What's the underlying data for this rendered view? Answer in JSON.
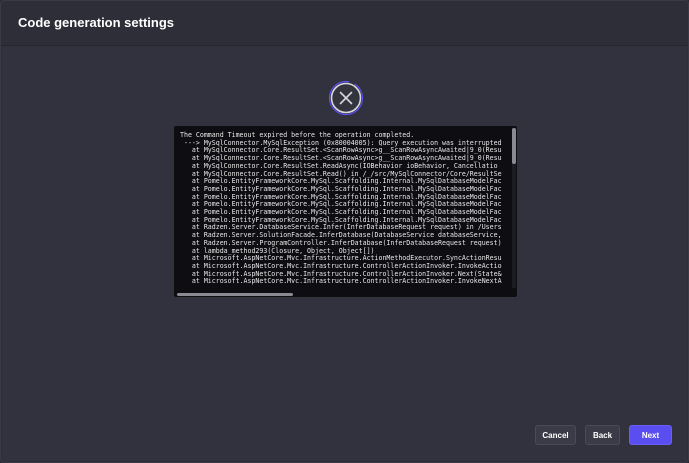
{
  "dialog": {
    "title": "Code generation settings"
  },
  "error": {
    "icon": "close-circle-icon",
    "log_lines": [
      "The Command Timeout expired before the operation completed.",
      " ---> MySqlConnector.MySqlException (0x80004005): Query execution was interrupted",
      "   at MySqlConnector.Core.ResultSet.<ScanRowAsync>g__ScanRowAsyncAwaited|9_0(Resu",
      "   at MySqlConnector.Core.ResultSet.<ScanRowAsync>g__ScanRowAsyncAwaited|9_0(Resu",
      "   at MySqlConnector.Core.ResultSet.ReadAsync(IOBehavior ioBehavior, Cancellatio",
      "   at MySqlConnector.Core.ResultSet.Read() in /_/src/MySqlConnector/Core/ResultSe",
      "   at Pomelo.EntityFrameworkCore.MySql.Scaffolding.Internal.MySqlDatabaseModelFac",
      "   at Pomelo.EntityFrameworkCore.MySql.Scaffolding.Internal.MySqlDatabaseModelFac",
      "   at Pomelo.EntityFrameworkCore.MySql.Scaffolding.Internal.MySqlDatabaseModelFac",
      "   at Pomelo.EntityFrameworkCore.MySql.Scaffolding.Internal.MySqlDatabaseModelFac",
      "   at Pomelo.EntityFrameworkCore.MySql.Scaffolding.Internal.MySqlDatabaseModelFac",
      "   at Pomelo.EntityFrameworkCore.MySql.Scaffolding.Internal.MySqlDatabaseModelFac",
      "   at Radzen.Server.DatabaseService.Infer(InferDatabaseRequest request) in /Users",
      "   at Radzen.Server.SolutionFacade.InferDatabase(DatabaseService databaseService,",
      "   at Radzen.Server.ProgramController.InferDatabase(InferDatabaseRequest request)",
      "   at lambda_method293(Closure, Object, Object[])",
      "   at Microsoft.AspNetCore.Mvc.Infrastructure.ActionMethodExecutor.SyncActionResu",
      "   at Microsoft.AspNetCore.Mvc.Infrastructure.ControllerActionInvoker.InvokeActio",
      "   at Microsoft.AspNetCore.Mvc.Infrastructure.ControllerActionInvoker.Next(State&",
      "   at Microsoft.AspNetCore.Mvc.Infrastructure.ControllerActionInvoker.InvokeNextA"
    ]
  },
  "footer": {
    "cancel_label": "Cancel",
    "back_label": "Back",
    "next_label": "Next"
  },
  "colors": {
    "primary": "#5b4ef0",
    "icon_ring": "#5b4ef0"
  }
}
